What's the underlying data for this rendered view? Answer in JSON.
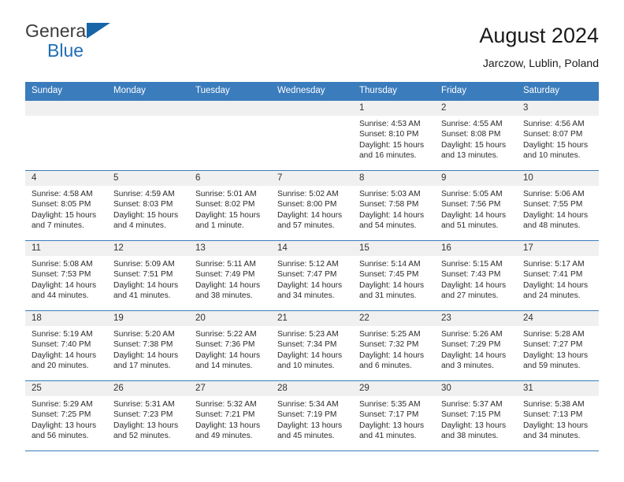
{
  "brand": {
    "word1": "General",
    "word2": "Blue",
    "flag": "triangle-flag-icon",
    "accent": "#1565a8"
  },
  "header": {
    "title": "August 2024",
    "location": "Jarczow, Lublin, Poland"
  },
  "calendar": {
    "header_bg": "#3b7cbd",
    "daynum_bg": "#f0f0f0",
    "weekdays": [
      "Sunday",
      "Monday",
      "Tuesday",
      "Wednesday",
      "Thursday",
      "Friday",
      "Saturday"
    ],
    "weeks": [
      [
        {
          "day": "",
          "empty": true,
          "lines": []
        },
        {
          "day": "",
          "empty": true,
          "lines": []
        },
        {
          "day": "",
          "empty": true,
          "lines": []
        },
        {
          "day": "",
          "empty": true,
          "lines": []
        },
        {
          "day": "1",
          "lines": [
            "Sunrise: 4:53 AM",
            "Sunset: 8:10 PM",
            "Daylight: 15 hours",
            "and 16 minutes."
          ]
        },
        {
          "day": "2",
          "lines": [
            "Sunrise: 4:55 AM",
            "Sunset: 8:08 PM",
            "Daylight: 15 hours",
            "and 13 minutes."
          ]
        },
        {
          "day": "3",
          "lines": [
            "Sunrise: 4:56 AM",
            "Sunset: 8:07 PM",
            "Daylight: 15 hours",
            "and 10 minutes."
          ]
        }
      ],
      [
        {
          "day": "4",
          "lines": [
            "Sunrise: 4:58 AM",
            "Sunset: 8:05 PM",
            "Daylight: 15 hours",
            "and 7 minutes."
          ]
        },
        {
          "day": "5",
          "lines": [
            "Sunrise: 4:59 AM",
            "Sunset: 8:03 PM",
            "Daylight: 15 hours",
            "and 4 minutes."
          ]
        },
        {
          "day": "6",
          "lines": [
            "Sunrise: 5:01 AM",
            "Sunset: 8:02 PM",
            "Daylight: 15 hours",
            "and 1 minute."
          ]
        },
        {
          "day": "7",
          "lines": [
            "Sunrise: 5:02 AM",
            "Sunset: 8:00 PM",
            "Daylight: 14 hours",
            "and 57 minutes."
          ]
        },
        {
          "day": "8",
          "lines": [
            "Sunrise: 5:03 AM",
            "Sunset: 7:58 PM",
            "Daylight: 14 hours",
            "and 54 minutes."
          ]
        },
        {
          "day": "9",
          "lines": [
            "Sunrise: 5:05 AM",
            "Sunset: 7:56 PM",
            "Daylight: 14 hours",
            "and 51 minutes."
          ]
        },
        {
          "day": "10",
          "lines": [
            "Sunrise: 5:06 AM",
            "Sunset: 7:55 PM",
            "Daylight: 14 hours",
            "and 48 minutes."
          ]
        }
      ],
      [
        {
          "day": "11",
          "lines": [
            "Sunrise: 5:08 AM",
            "Sunset: 7:53 PM",
            "Daylight: 14 hours",
            "and 44 minutes."
          ]
        },
        {
          "day": "12",
          "lines": [
            "Sunrise: 5:09 AM",
            "Sunset: 7:51 PM",
            "Daylight: 14 hours",
            "and 41 minutes."
          ]
        },
        {
          "day": "13",
          "lines": [
            "Sunrise: 5:11 AM",
            "Sunset: 7:49 PM",
            "Daylight: 14 hours",
            "and 38 minutes."
          ]
        },
        {
          "day": "14",
          "lines": [
            "Sunrise: 5:12 AM",
            "Sunset: 7:47 PM",
            "Daylight: 14 hours",
            "and 34 minutes."
          ]
        },
        {
          "day": "15",
          "lines": [
            "Sunrise: 5:14 AM",
            "Sunset: 7:45 PM",
            "Daylight: 14 hours",
            "and 31 minutes."
          ]
        },
        {
          "day": "16",
          "lines": [
            "Sunrise: 5:15 AM",
            "Sunset: 7:43 PM",
            "Daylight: 14 hours",
            "and 27 minutes."
          ]
        },
        {
          "day": "17",
          "lines": [
            "Sunrise: 5:17 AM",
            "Sunset: 7:41 PM",
            "Daylight: 14 hours",
            "and 24 minutes."
          ]
        }
      ],
      [
        {
          "day": "18",
          "lines": [
            "Sunrise: 5:19 AM",
            "Sunset: 7:40 PM",
            "Daylight: 14 hours",
            "and 20 minutes."
          ]
        },
        {
          "day": "19",
          "lines": [
            "Sunrise: 5:20 AM",
            "Sunset: 7:38 PM",
            "Daylight: 14 hours",
            "and 17 minutes."
          ]
        },
        {
          "day": "20",
          "lines": [
            "Sunrise: 5:22 AM",
            "Sunset: 7:36 PM",
            "Daylight: 14 hours",
            "and 14 minutes."
          ]
        },
        {
          "day": "21",
          "lines": [
            "Sunrise: 5:23 AM",
            "Sunset: 7:34 PM",
            "Daylight: 14 hours",
            "and 10 minutes."
          ]
        },
        {
          "day": "22",
          "lines": [
            "Sunrise: 5:25 AM",
            "Sunset: 7:32 PM",
            "Daylight: 14 hours",
            "and 6 minutes."
          ]
        },
        {
          "day": "23",
          "lines": [
            "Sunrise: 5:26 AM",
            "Sunset: 7:29 PM",
            "Daylight: 14 hours",
            "and 3 minutes."
          ]
        },
        {
          "day": "24",
          "lines": [
            "Sunrise: 5:28 AM",
            "Sunset: 7:27 PM",
            "Daylight: 13 hours",
            "and 59 minutes."
          ]
        }
      ],
      [
        {
          "day": "25",
          "lines": [
            "Sunrise: 5:29 AM",
            "Sunset: 7:25 PM",
            "Daylight: 13 hours",
            "and 56 minutes."
          ]
        },
        {
          "day": "26",
          "lines": [
            "Sunrise: 5:31 AM",
            "Sunset: 7:23 PM",
            "Daylight: 13 hours",
            "and 52 minutes."
          ]
        },
        {
          "day": "27",
          "lines": [
            "Sunrise: 5:32 AM",
            "Sunset: 7:21 PM",
            "Daylight: 13 hours",
            "and 49 minutes."
          ]
        },
        {
          "day": "28",
          "lines": [
            "Sunrise: 5:34 AM",
            "Sunset: 7:19 PM",
            "Daylight: 13 hours",
            "and 45 minutes."
          ]
        },
        {
          "day": "29",
          "lines": [
            "Sunrise: 5:35 AM",
            "Sunset: 7:17 PM",
            "Daylight: 13 hours",
            "and 41 minutes."
          ]
        },
        {
          "day": "30",
          "lines": [
            "Sunrise: 5:37 AM",
            "Sunset: 7:15 PM",
            "Daylight: 13 hours",
            "and 38 minutes."
          ]
        },
        {
          "day": "31",
          "lines": [
            "Sunrise: 5:38 AM",
            "Sunset: 7:13 PM",
            "Daylight: 13 hours",
            "and 34 minutes."
          ]
        }
      ]
    ]
  }
}
